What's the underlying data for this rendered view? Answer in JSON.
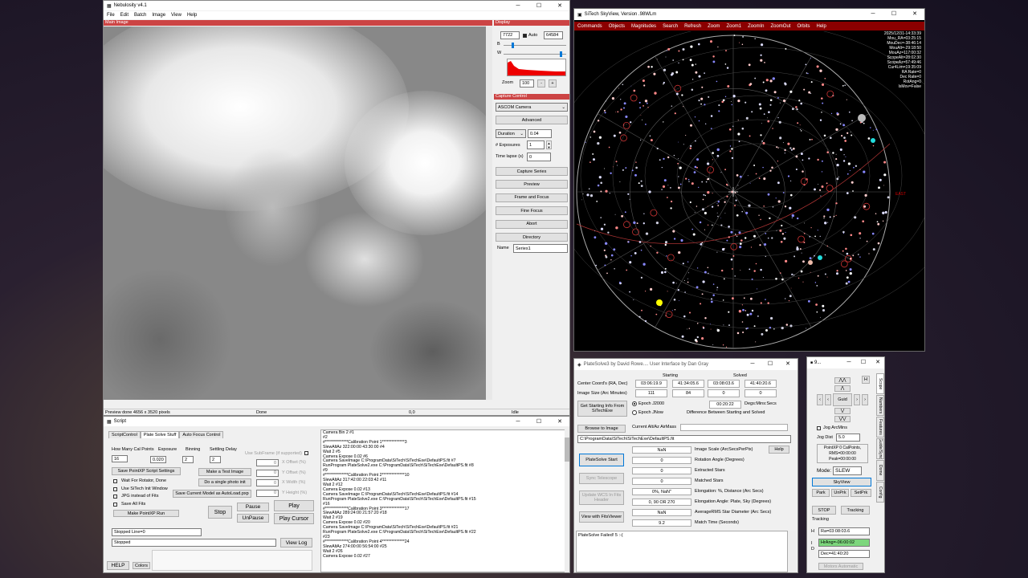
{
  "nebulosity": {
    "title": "Nebulosity v4.1",
    "menu": [
      "File",
      "Edit",
      "Batch",
      "Image",
      "View",
      "Help"
    ],
    "main_label": "Main Image",
    "display": {
      "label": "Display",
      "low": "7722",
      "auto": "Auto",
      "high": "64584",
      "b": "B",
      "w": "W",
      "zoom_label": "Zoom",
      "zoom": "100",
      "minus": "-",
      "plus": "+"
    },
    "capture": {
      "label": "Capture Control",
      "camera": "ASCOM Camera",
      "advanced": "Advanced",
      "duration_label": "Duration",
      "duration": "0.04",
      "exposures_label": "# Exposures",
      "exposures": "1",
      "timelapse_label": "Time lapse (s)",
      "timelapse": "0",
      "buttons": [
        "Capture Series",
        "Preview",
        "Frame and Focus",
        "Fine Focus",
        "Abort",
        "Directory"
      ],
      "name_label": "Name",
      "name": "Series1"
    },
    "status": {
      "preview": "Preview done 4656 x 3520 pixels",
      "done": "Done",
      "coord": "0,0",
      "idle": "Idle"
    }
  },
  "script": {
    "title": "Script",
    "tabs": [
      "ScriptControl",
      "Plate Solve Stuff",
      "Auto Focus Control"
    ],
    "cal_label": "How Many Cal Points",
    "cal": "16",
    "exposure_label": "Exposure",
    "exposure": "0.020",
    "binning_label": "Binning",
    "binning": "2",
    "settle_label": "Settling Delay",
    "settle": "2",
    "subframe": "Use SubFrame (if supported)",
    "xoff": "X Offset (%)",
    "yoff": "Y Offset (%)",
    "xwid": "X Width (%)",
    "yhei": "Y Height (%)",
    "zero": "0",
    "save_pointxp": "Save PointXP Script Settings",
    "test_image": "Make a Test Image",
    "photo_init": "Do a single photo init",
    "save_model": "Save Current Model as AutoLoad.pxp",
    "checks": [
      "Wait For Rotator,  Done",
      "Use SiTech Init Window",
      "JPG instead of Fits",
      "Save All Fits"
    ],
    "make_run": "Make PointXP Run",
    "stop": "Stop",
    "pause": "Pause",
    "unpause": "UnPause",
    "play": "Play",
    "play_cursor": "Play Cursor",
    "stopped_line": "Stopped  Line=0",
    "stopped": "Stopped",
    "view_log": "View Log",
    "help": "HELP",
    "colors": "Colors",
    "log": [
      "Camera Bin 2 #1",
      "#2",
      "#**************Calibration Point 1**************3",
      "SlewAltAz 322:00:00 43:30:00 #4",
      "Wait 2 #5",
      "Camera Expose 0.02 #6",
      "Camera SaveImage C:\\ProgramData\\SiTech\\SiTechExe\\DefaultPS.fit #7",
      "RunProgram PlateSolve2.exe C:\\ProgramData\\SiTech\\SiTechExe\\DefaultPS.fit #8",
      "#9",
      "#**************Calibration Point 2**************10",
      "SlewAltAz 317:42:00 22:03:42 #11",
      "Wait 2 #12",
      "Camera Expose 0.02 #13",
      "Camera SaveImage C:\\ProgramData\\SiTech\\SiTechExe\\DefaultPS.fit #14",
      "RunProgram PlateSolve2.exe C:\\ProgramData\\SiTech\\SiTechExe\\DefaultPS.fit #15",
      "#16",
      "#**************Calibration Point 3**************17",
      "SlewAltAz 289:24:00 21:57:20 #18",
      "Wait 2 #19",
      "Camera Expose 0.02 #20",
      "Camera SaveImage C:\\ProgramData\\SiTech\\SiTechExe\\DefaultPS.fit #21",
      "RunProgram PlateSolve2.exe C:\\ProgramData\\SiTech\\SiTechExe\\DefaultPS.fit #22",
      "#23",
      "#**************Calibration Point 4**************24",
      "SlewAltAz 274:00:00 56:54:00 #25",
      "Wait 2 #26",
      "Camera Expose 0.02 #27"
    ]
  },
  "skyview": {
    "title": "SiTech SkyView, Version .98WLm",
    "menu": [
      "Commands",
      "Objects",
      "Magnitudes",
      "Search",
      "Refresh",
      "Zoom",
      "Zoom1",
      "ZoomIn",
      "ZoomOut",
      "Orbits",
      "Help"
    ],
    "readout": [
      "2025/12/31-14:33:39",
      "Mou_RA=03:25:15",
      "MouDec=-38:46:14",
      "MouAlt=-29:18:50",
      "MouAz=117:00:32",
      "ScopeAlt=28:02:30",
      "ScopeAz=57:49:46",
      "Cur4Lim=19:35:09",
      "RA Rate=0",
      "Dec Rate=0",
      "RotAng=0",
      "IsMov=False"
    ],
    "east": "EAST"
  },
  "platesolve": {
    "title": "PlateSolve3 by David Rowe.... User Interface by Dan Gray",
    "starting": "Starting",
    "solved": "Solved",
    "center_label": "Center Coord's (RA, Dec)",
    "size_label": "Image Size (Arc Minutes)",
    "start_ra": "03:06:19.9",
    "start_dec": "41:34:05.6",
    "sol_ra": "03:08:03.6",
    "sol_dec": "41:40:20.6",
    "size1": "111",
    "size2": "84",
    "size3": "0",
    "size4": "0",
    "get_start": "Get Starting Info From SiTechExe",
    "epoch2000": "Epoch J2000",
    "epochnow": "Epoch JNow",
    "diff_val": "00:20:22",
    "diff_unit": "Degs:Mins:Secs",
    "diff_label": "Difference Between Starting and Solved",
    "airmass_label": "Current Alt/Az AirMass",
    "browse": "Browse to Image",
    "path": "C:\\ProgramData\\SiTech\\SiTechExe\\DefaultPS.fit",
    "start": "PlateSolve Start",
    "sync": "Sync Telescope",
    "update_wcs": "Update WCS In Fits Header",
    "view_fits": "View with FitsViewer",
    "help": "Help",
    "results": [
      {
        "v": "NaN",
        "l": "Image Scale (ArcSecsPerPix)"
      },
      {
        "v": "0",
        "l": "Rotation Angle (Degrees)"
      },
      {
        "v": "0",
        "l": "Extracted Stars"
      },
      {
        "v": "0",
        "l": "Matched Stars"
      },
      {
        "v": "0%,    NaN\"",
        "l": "Elongation:  %,  Distance (Arc Secs)"
      },
      {
        "v": "0,  90  OR 270",
        "l": "Elongation Angle:  Plate, Sky (Degrees)"
      },
      {
        "v": "NaN",
        "l": "AverageRMS Star Diameter (Arc Secs)"
      },
      {
        "v": "9.2",
        "l": "Match Time (Seconds)"
      }
    ],
    "failed": "PlateSolve Failed! 5  :-("
  },
  "scope": {
    "title": "9...",
    "guid": "Guid",
    "h": "H",
    "jog_label": "Jog ArcMins",
    "jog_dist_label": "Jog Dist",
    "jog_dist": "5.0",
    "pointxp": "PointXP 0 CalPoints,",
    "rms": "RMS=00:00:00",
    "peak": "Peak=00:00:00",
    "mode_label": "Mode:",
    "mode": "SLEW",
    "skyview": "SkyView",
    "park": "Park",
    "unprk": "UnPrk",
    "setprk": "SetPrk",
    "stop": "STOP",
    "tracking_btn": "Tracking",
    "tracking": "Tracking",
    "ra": "Ra=03:08:03.6",
    "hrang": "HrAng=-06:00:02",
    "dec": "Dec=41:40:20",
    "motors": "Motors Automatic",
    "side_tabs": [
      "Scope",
      "Numbers",
      "Features",
      "Guide/Sync",
      "Dome",
      "Config"
    ]
  }
}
